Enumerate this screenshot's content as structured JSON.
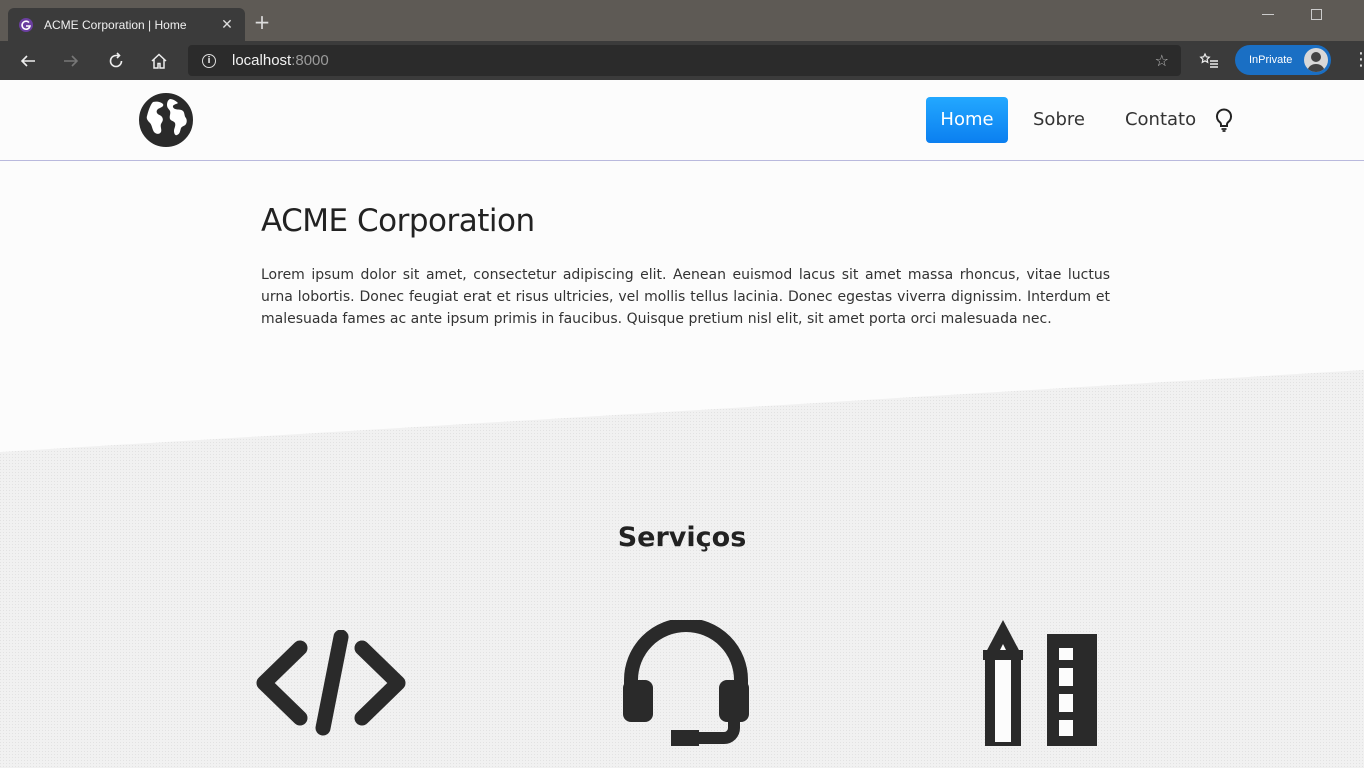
{
  "browser": {
    "tab_title": "ACME Corporation | Home",
    "address_host": "localhost",
    "address_port": ":8000",
    "inprivate_label": "InPrivate"
  },
  "header": {
    "nav": [
      {
        "label": "Home",
        "active": true
      },
      {
        "label": "Sobre",
        "active": false
      },
      {
        "label": "Contato",
        "active": false
      }
    ]
  },
  "hero": {
    "title": "ACME Corporation",
    "text": "Lorem ipsum dolor sit amet, consectetur adipiscing elit. Aenean euismod lacus sit amet massa rhoncus, vitae luctus urna lobortis. Donec feugiat erat et risus ultricies, vel mollis tellus lacinia. Donec egestas viverra dignissim. Interdum et malesuada fames ac ante ipsum primis in faucibus. Quisque pretium nisl elit, sit amet porta orci malesuada nec."
  },
  "services": {
    "title": "Serviços",
    "items": [
      {
        "icon": "code-icon"
      },
      {
        "icon": "headset-icon"
      },
      {
        "icon": "pencil-ruler-icon"
      }
    ]
  },
  "colors": {
    "nav_active": "#0b7ff0",
    "browser_frame": "#3b3b3b",
    "inprivate": "#1a6fc4",
    "text": "#222222"
  }
}
